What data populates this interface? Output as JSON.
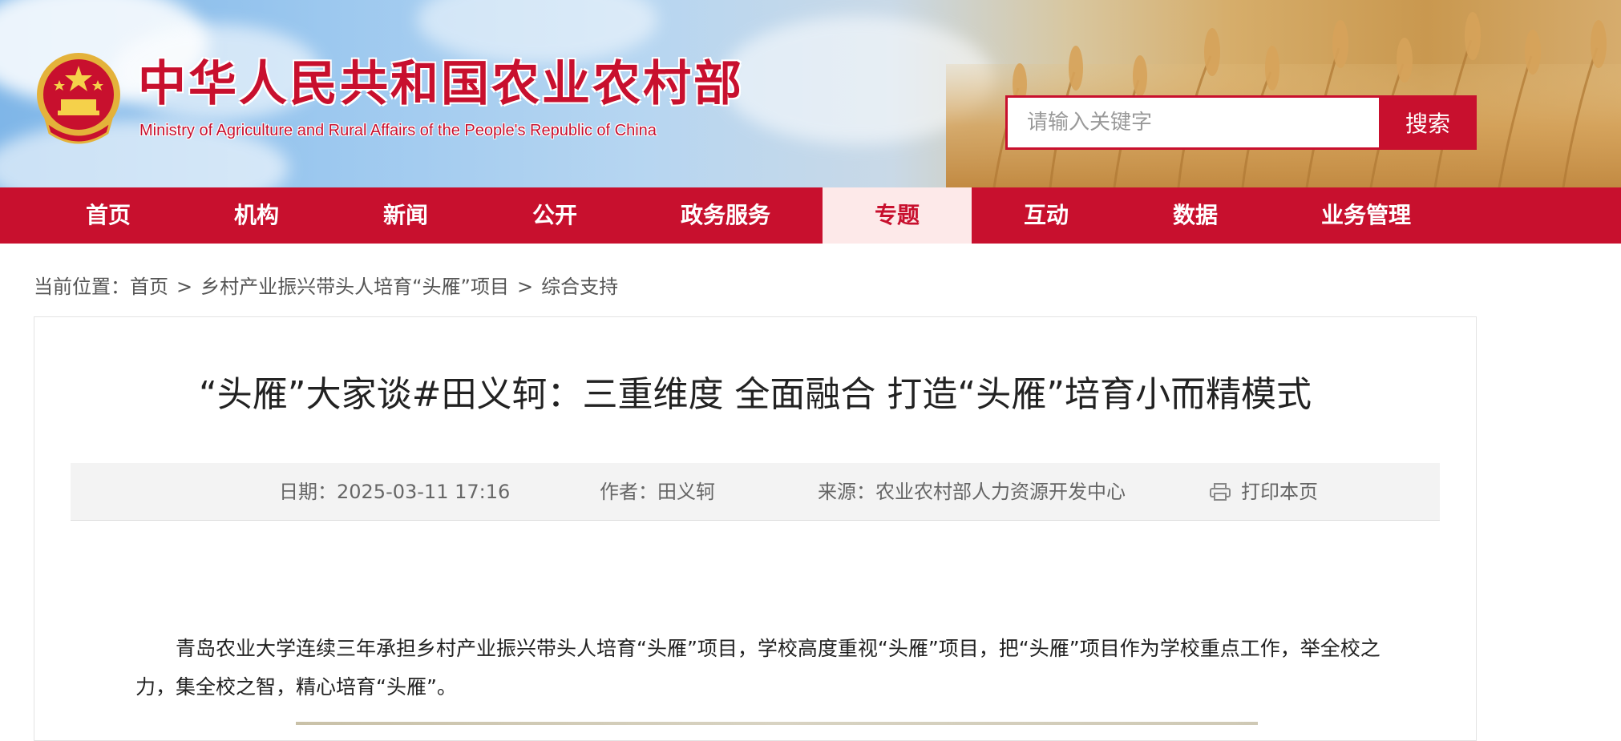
{
  "header": {
    "title_cn": "中华人民共和国农业农村部",
    "title_en": "Ministry of Agriculture and Rural Affairs of the People's Republic of China",
    "emblem_icon": "national-emblem-icon",
    "search_placeholder": "请输入关键字",
    "search_button": "搜索"
  },
  "nav": {
    "items": [
      {
        "label": "首页"
      },
      {
        "label": "机构"
      },
      {
        "label": "新闻"
      },
      {
        "label": "公开"
      },
      {
        "label": "政务服务"
      },
      {
        "label": "专题"
      },
      {
        "label": "互动"
      },
      {
        "label": "数据"
      },
      {
        "label": "业务管理"
      }
    ],
    "active": "专题"
  },
  "breadcrumb": {
    "prefix": "当前位置：",
    "items": [
      "首页",
      "乡村产业振兴带头人培育“头雁”项目",
      "综合支持"
    ],
    "separator": ">"
  },
  "article": {
    "title": "“头雁”大家谈#田义轲：三重维度 全面融合 打造“头雁”培育小而精模式",
    "meta": {
      "date": "日期：2025-03-11 17:16",
      "author": "作者：田义轲",
      "source": "来源：农业农村部人力资源开发中心",
      "print": "打印本页",
      "print_icon": "printer-icon"
    },
    "body": "青岛农业大学连续三年承担乡村产业振兴带头人培育“头雁”项目，学校高度重视“头雁”项目，把“头雁”项目作为学校重点工作，举全校之力，集全校之智，精心培育“头雁”。"
  },
  "colors": {
    "brand_red": "#c8102e",
    "nav_active_bg": "#fde9e9",
    "meta_bg": "#f3f3f3"
  }
}
